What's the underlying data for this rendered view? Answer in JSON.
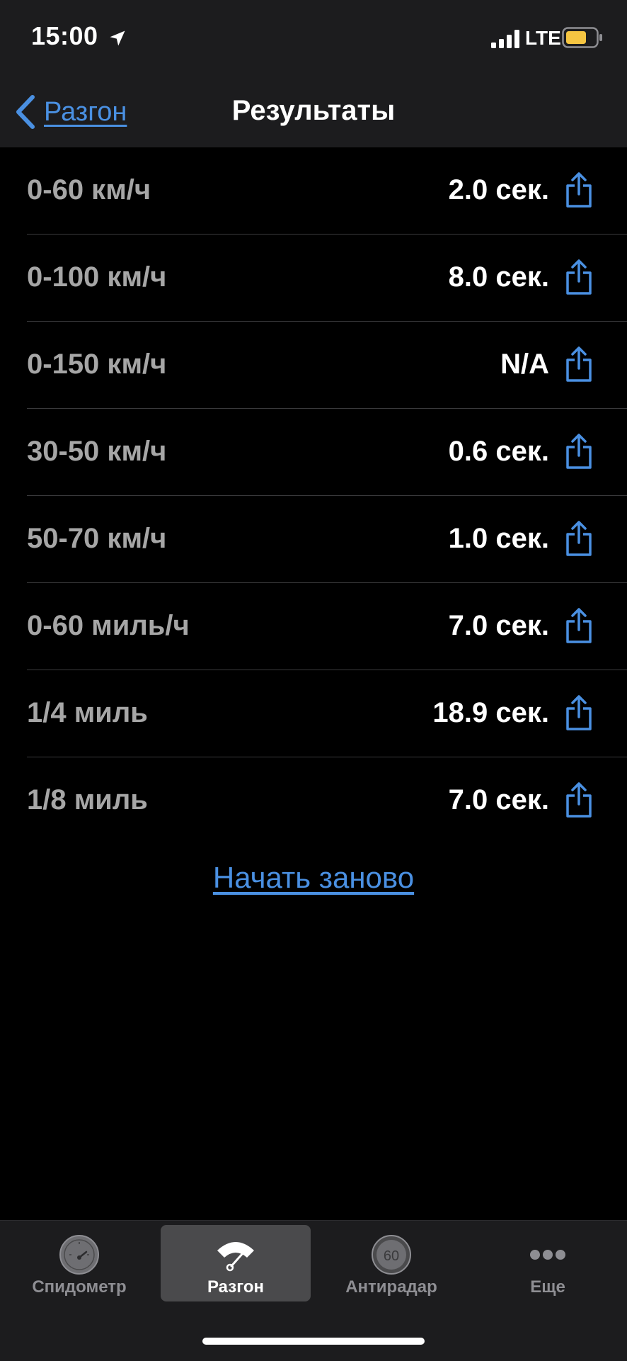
{
  "status_bar": {
    "time": "15:00",
    "network": "LTE",
    "battery_color": "#f5c542"
  },
  "nav": {
    "back_label": "Разгон",
    "title": "Результаты"
  },
  "results": [
    {
      "label": "0-60 км/ч",
      "value": "2.0 сек."
    },
    {
      "label": "0-100 км/ч",
      "value": "8.0 сек."
    },
    {
      "label": "0-150 км/ч",
      "value": "N/A"
    },
    {
      "label": "30-50 км/ч",
      "value": "0.6 сек."
    },
    {
      "label": "50-70 км/ч",
      "value": "1.0 сек."
    },
    {
      "label": "0-60 миль/ч",
      "value": "7.0 сек."
    },
    {
      "label": "1/4 миль",
      "value": "18.9 сек."
    },
    {
      "label": "1/8 миль",
      "value": "7.0 сек."
    }
  ],
  "restart_label": "Начать заново",
  "tabs": [
    {
      "label": "Спидометр",
      "icon": "speedometer-icon",
      "active": false
    },
    {
      "label": "Разгон",
      "icon": "acceleration-icon",
      "active": true
    },
    {
      "label": "Антирадар",
      "icon": "speed-limit-icon",
      "icon_text": "60",
      "active": false
    },
    {
      "label": "Еще",
      "icon": "more-icon",
      "active": false
    }
  ],
  "colors": {
    "accent": "#4a90e2",
    "background": "#000000",
    "bar": "#1c1c1e",
    "label": "#a6a6a6"
  }
}
